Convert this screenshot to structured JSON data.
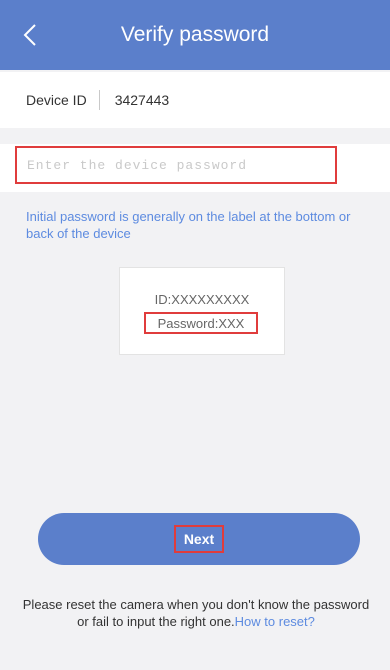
{
  "header": {
    "title": "Verify password",
    "back_icon": "chevron-left-icon"
  },
  "device": {
    "label": "Device ID",
    "value": "3427443"
  },
  "password_field": {
    "placeholder": "Enter the device password",
    "value": ""
  },
  "hint": "Initial password is generally on the label at the bottom or back of the device",
  "label_example": {
    "id_text": "ID:XXXXXXXXX",
    "password_text": "Password:XXX"
  },
  "next_button": {
    "label": "Next"
  },
  "reset": {
    "text": "Please reset the camera when you don't know the password or fail to input the right one.",
    "link": "How to reset?"
  },
  "colors": {
    "header": "#5b7fcb",
    "accent_link": "#5d8be0",
    "highlight": "#e03c3c",
    "background": "#f2f2f4"
  }
}
